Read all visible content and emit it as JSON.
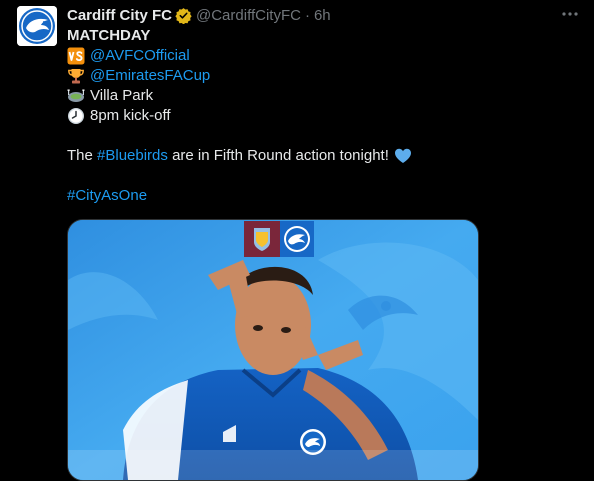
{
  "tweet": {
    "author_name": "Cardiff City FC",
    "author_handle": "@CardiffCityFC",
    "separator": "·",
    "time": "6h",
    "lines": {
      "heading": "MATCHDAY",
      "opponent_mention": "@AVFCOfficial",
      "competition_mention": "@EmiratesFACup",
      "venue": "Villa Park",
      "kickoff": "8pm kick-off",
      "sentence_start": "The ",
      "sentence_hashtag": "#Bluebirds",
      "sentence_end": " are in Fifth Round action tonight!",
      "hashtag": "#CityAsOne"
    },
    "icons": {
      "verified": "verified-badge-icon",
      "more": "more-options-icon",
      "vs": "vs-emoji-icon",
      "trophy": "trophy-emoji-icon",
      "stadium": "stadium-emoji-icon",
      "clock": "clock-emoji-icon",
      "heart": "blue-heart-emoji-icon"
    },
    "colors": {
      "background": "#000000",
      "text": "#e7e9ea",
      "muted": "#71767b",
      "link": "#1d9bf0",
      "verified_gold": "#e2b719",
      "cardiff_blue": "#1768c6",
      "villa_claret": "#7a263a"
    }
  }
}
